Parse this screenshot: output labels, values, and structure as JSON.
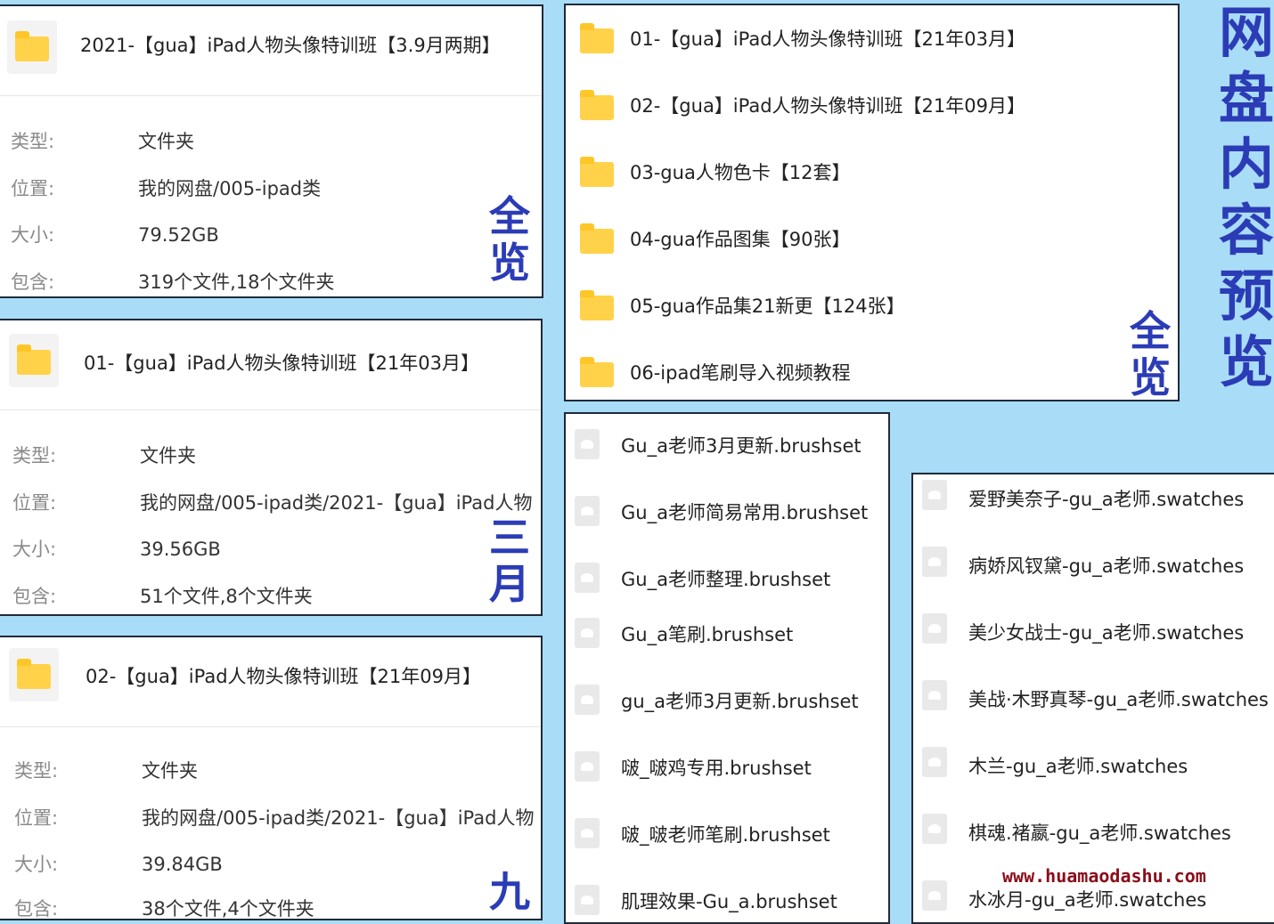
{
  "info_panels": [
    {
      "title": "2021-【gua】iPad人物头像特训班【3.9月两期】",
      "rows": [
        {
          "key": "类型:",
          "value": "文件夹"
        },
        {
          "key": "位置:",
          "value": "我的网盘/005-ipad类"
        },
        {
          "key": "大小:",
          "value": "79.52GB"
        },
        {
          "key": "包含:",
          "value": "319个文件,18个文件夹"
        }
      ],
      "tag": [
        "全",
        "览"
      ]
    },
    {
      "title": "01-【gua】iPad人物头像特训班【21年03月】",
      "rows": [
        {
          "key": "类型:",
          "value": "文件夹"
        },
        {
          "key": "位置:",
          "value": "我的网盘/005-ipad类/2021-【gua】iPad人物"
        },
        {
          "key": "大小:",
          "value": "39.56GB"
        },
        {
          "key": "包含:",
          "value": "51个文件,8个文件夹"
        }
      ],
      "tag": [
        "三",
        "月"
      ]
    },
    {
      "title": "02-【gua】iPad人物头像特训班【21年09月】",
      "rows": [
        {
          "key": "类型:",
          "value": "文件夹"
        },
        {
          "key": "位置:",
          "value": "我的网盘/005-ipad类/2021-【gua】iPad人物"
        },
        {
          "key": "大小:",
          "value": "39.84GB"
        },
        {
          "key": "包含:",
          "value": "38个文件,4个文件夹"
        }
      ],
      "tag": [
        "九"
      ]
    }
  ],
  "folder_list": {
    "items": [
      "01-【gua】iPad人物头像特训班【21年03月】",
      "02-【gua】iPad人物头像特训班【21年09月】",
      "03-gua人物色卡【12套】",
      "04-gua作品图集【90张】",
      "05-gua作品集21新更【124张】",
      "06-ipad笔刷导入视频教程"
    ],
    "tag": [
      "全",
      "览"
    ]
  },
  "brushset_list": [
    "Gu_a老师3月更新.brushset",
    "Gu_a老师简易常用.brushset",
    "Gu_a老师整理.brushset",
    "Gu_a笔刷.brushset",
    "gu_a老师3月更新.brushset",
    "啵_啵鸡专用.brushset",
    "啵_啵老师笔刷.brushset",
    "肌理效果-Gu_a.brushset"
  ],
  "swatches_list": [
    "爱野美奈子-gu_a老师.swatches",
    "病娇风钗黛-gu_a老师.swatches",
    "美少女战士-gu_a老师.swatches",
    "美战·木野真琴-gu_a老师.swatches",
    "木兰-gu_a老师.swatches",
    "棋魂.褚嬴-gu_a老师.swatches",
    "水冰月-gu_a老师.swatches"
  ],
  "side_title": [
    "网",
    "盘",
    "内",
    "容",
    "预",
    "览"
  ],
  "watermark": "www.huamaodashu.com",
  "colors": {
    "background": "#a9dcf7",
    "tag": "#2b3cb6",
    "folder": "#ffd24a",
    "watermark": "#8b0d1a"
  }
}
